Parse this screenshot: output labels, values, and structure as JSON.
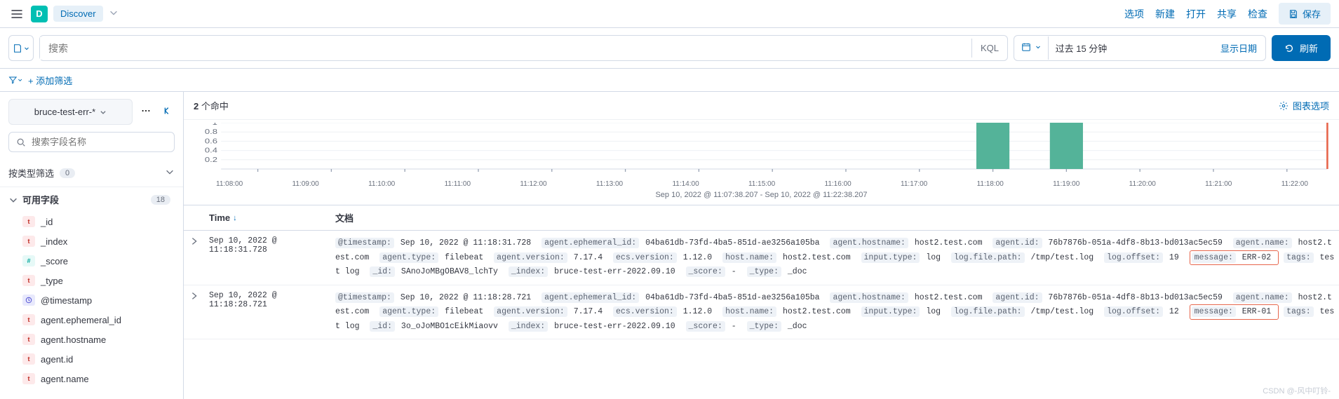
{
  "header": {
    "app_initial": "D",
    "discover_label": "Discover",
    "actions": {
      "options": "选项",
      "new": "新建",
      "open": "打开",
      "share": "共享",
      "inspect": "检查",
      "save": "保存"
    }
  },
  "query": {
    "search_placeholder": "搜索",
    "kql_label": "KQL",
    "date_range": "过去 15 分钟",
    "show_dates": "显示日期",
    "refresh": "刷新"
  },
  "filter": {
    "add_filter": "+ 添加筛选"
  },
  "sidebar": {
    "index_pattern": "bruce-test-err-*",
    "field_search_placeholder": "搜索字段名称",
    "type_filter_label": "按类型筛选",
    "type_filter_count": "0",
    "available_fields_label": "可用字段",
    "available_fields_count": "18",
    "fields": [
      {
        "token": "t",
        "name": "_id"
      },
      {
        "token": "t",
        "name": "_index"
      },
      {
        "token": "n",
        "name": "_score"
      },
      {
        "token": "t",
        "name": "_type"
      },
      {
        "token": "d",
        "name": "@timestamp"
      },
      {
        "token": "t",
        "name": "agent.ephemeral_id"
      },
      {
        "token": "t",
        "name": "agent.hostname"
      },
      {
        "token": "t",
        "name": "agent.id"
      },
      {
        "token": "t",
        "name": "agent.name"
      }
    ]
  },
  "results": {
    "hit_count_prefix": "2",
    "hit_count_suffix": " 个命中",
    "chart_options_label": "图表选项",
    "time_caption": "Sep 10, 2022 @ 11:07:38.207 - Sep 10, 2022 @ 11:22:38.207",
    "columns": {
      "time": "Time",
      "doc": "文档"
    }
  },
  "chart_data": {
    "type": "bar",
    "categories": [
      "11:08:00",
      "11:09:00",
      "11:10:00",
      "11:11:00",
      "11:12:00",
      "11:13:00",
      "11:14:00",
      "11:15:00",
      "11:16:00",
      "11:17:00",
      "11:18:00",
      "11:19:00",
      "11:20:00",
      "11:21:00",
      "11:22:00"
    ],
    "values": [
      0,
      0,
      0,
      0,
      0,
      0,
      0,
      0,
      0,
      0,
      1,
      1,
      0,
      0,
      0
    ],
    "ylim": [
      0,
      1
    ],
    "yticks": [
      0.2,
      0.4,
      0.6,
      0.8,
      1
    ],
    "title": "",
    "xlabel": "",
    "ylabel": ""
  },
  "documents": [
    {
      "time": "Sep 10, 2022 @ 11:18:31.728",
      "fields": [
        {
          "k": "@timestamp",
          "v": "Sep 10, 2022 @ 11:18:31.728"
        },
        {
          "k": "agent.ephemeral_id",
          "v": "04ba61db-73fd-4ba5-851d-ae3256a105ba"
        },
        {
          "k": "agent.hostname",
          "v": "host2.test.com"
        },
        {
          "k": "agent.id",
          "v": "76b7876b-051a-4df8-8b13-bd013ac5ec59"
        },
        {
          "k": "agent.name",
          "v": "host2.test.com"
        },
        {
          "k": "agent.type",
          "v": "filebeat"
        },
        {
          "k": "agent.version",
          "v": "7.17.4"
        },
        {
          "k": "ecs.version",
          "v": "1.12.0"
        },
        {
          "k": "host.name",
          "v": "host2.test.com"
        },
        {
          "k": "input.type",
          "v": "log"
        },
        {
          "k": "log.file.path",
          "v": "/tmp/test.log"
        },
        {
          "k": "log.offset",
          "v": "19"
        },
        {
          "k": "message",
          "v": "ERR-02",
          "hl": true
        },
        {
          "k": "tags",
          "v": "test log"
        },
        {
          "k": "_id",
          "v": "SAnoJoMBgOBAV8_lchTy"
        },
        {
          "k": "_index",
          "v": "bruce-test-err-2022.09.10"
        },
        {
          "k": "_score",
          "v": " - "
        },
        {
          "k": "_type",
          "v": "_doc"
        }
      ]
    },
    {
      "time": "Sep 10, 2022 @ 11:18:28.721",
      "fields": [
        {
          "k": "@timestamp",
          "v": "Sep 10, 2022 @ 11:18:28.721"
        },
        {
          "k": "agent.ephemeral_id",
          "v": "04ba61db-73fd-4ba5-851d-ae3256a105ba"
        },
        {
          "k": "agent.hostname",
          "v": "host2.test.com"
        },
        {
          "k": "agent.id",
          "v": "76b7876b-051a-4df8-8b13-bd013ac5ec59"
        },
        {
          "k": "agent.name",
          "v": "host2.test.com"
        },
        {
          "k": "agent.type",
          "v": "filebeat"
        },
        {
          "k": "agent.version",
          "v": "7.17.4"
        },
        {
          "k": "ecs.version",
          "v": "1.12.0"
        },
        {
          "k": "host.name",
          "v": "host2.test.com"
        },
        {
          "k": "input.type",
          "v": "log"
        },
        {
          "k": "log.file.path",
          "v": "/tmp/test.log"
        },
        {
          "k": "log.offset",
          "v": "12"
        },
        {
          "k": "message",
          "v": "ERR-01",
          "hl": true
        },
        {
          "k": "tags",
          "v": "test log"
        },
        {
          "k": "_id",
          "v": "3o_oJoMBO1cEikMiaovv"
        },
        {
          "k": "_index",
          "v": "bruce-test-err-2022.09.10"
        },
        {
          "k": "_score",
          "v": " - "
        },
        {
          "k": "_type",
          "v": "_doc"
        }
      ]
    }
  ],
  "watermark": "CSDN @-风中叮铃-"
}
